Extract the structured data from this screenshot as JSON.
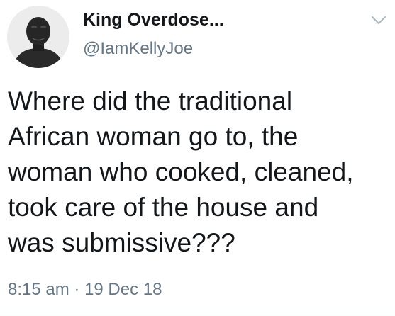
{
  "tweet": {
    "author": {
      "display_name": "King Overdose...",
      "handle": "@IamKellyJoe",
      "avatar_icon": "person-photo-avatar"
    },
    "menu_icon": "chevron-down-icon",
    "text": "Where did the traditional\nAfrican woman go to, the\nwoman who cooked, cleaned,\ntook care of the house and\nwas submissive???",
    "time": "8:15 am",
    "separator": "·",
    "date": "19 Dec 18"
  },
  "colors": {
    "primary_text": "#14171a",
    "secondary_text": "#657786",
    "divider": "#e6ecf0"
  }
}
